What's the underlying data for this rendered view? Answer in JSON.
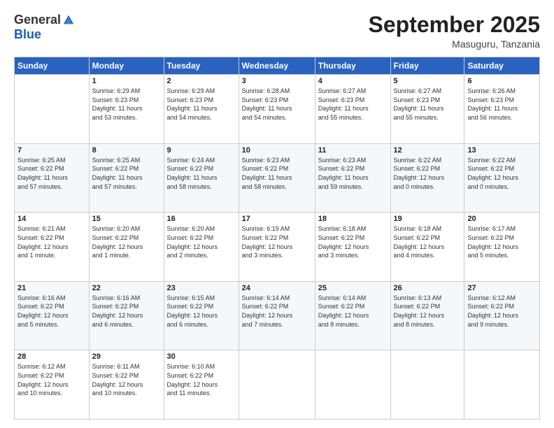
{
  "logo": {
    "general": "General",
    "blue": "Blue"
  },
  "header": {
    "month": "September 2025",
    "location": "Masuguru, Tanzania"
  },
  "weekdays": [
    "Sunday",
    "Monday",
    "Tuesday",
    "Wednesday",
    "Thursday",
    "Friday",
    "Saturday"
  ],
  "weeks": [
    [
      {
        "day": "",
        "info": ""
      },
      {
        "day": "1",
        "info": "Sunrise: 6:29 AM\nSunset: 6:23 PM\nDaylight: 11 hours\nand 53 minutes."
      },
      {
        "day": "2",
        "info": "Sunrise: 6:29 AM\nSunset: 6:23 PM\nDaylight: 11 hours\nand 54 minutes."
      },
      {
        "day": "3",
        "info": "Sunrise: 6:28 AM\nSunset: 6:23 PM\nDaylight: 11 hours\nand 54 minutes."
      },
      {
        "day": "4",
        "info": "Sunrise: 6:27 AM\nSunset: 6:23 PM\nDaylight: 11 hours\nand 55 minutes."
      },
      {
        "day": "5",
        "info": "Sunrise: 6:27 AM\nSunset: 6:23 PM\nDaylight: 11 hours\nand 55 minutes."
      },
      {
        "day": "6",
        "info": "Sunrise: 6:26 AM\nSunset: 6:23 PM\nDaylight: 11 hours\nand 56 minutes."
      }
    ],
    [
      {
        "day": "7",
        "info": "Sunrise: 6:25 AM\nSunset: 6:22 PM\nDaylight: 11 hours\nand 57 minutes."
      },
      {
        "day": "8",
        "info": "Sunrise: 6:25 AM\nSunset: 6:22 PM\nDaylight: 11 hours\nand 57 minutes."
      },
      {
        "day": "9",
        "info": "Sunrise: 6:24 AM\nSunset: 6:22 PM\nDaylight: 11 hours\nand 58 minutes."
      },
      {
        "day": "10",
        "info": "Sunrise: 6:23 AM\nSunset: 6:22 PM\nDaylight: 11 hours\nand 58 minutes."
      },
      {
        "day": "11",
        "info": "Sunrise: 6:23 AM\nSunset: 6:22 PM\nDaylight: 11 hours\nand 59 minutes."
      },
      {
        "day": "12",
        "info": "Sunrise: 6:22 AM\nSunset: 6:22 PM\nDaylight: 12 hours\nand 0 minutes."
      },
      {
        "day": "13",
        "info": "Sunrise: 6:22 AM\nSunset: 6:22 PM\nDaylight: 12 hours\nand 0 minutes."
      }
    ],
    [
      {
        "day": "14",
        "info": "Sunrise: 6:21 AM\nSunset: 6:22 PM\nDaylight: 12 hours\nand 1 minute."
      },
      {
        "day": "15",
        "info": "Sunrise: 6:20 AM\nSunset: 6:22 PM\nDaylight: 12 hours\nand 1 minute."
      },
      {
        "day": "16",
        "info": "Sunrise: 6:20 AM\nSunset: 6:22 PM\nDaylight: 12 hours\nand 2 minutes."
      },
      {
        "day": "17",
        "info": "Sunrise: 6:19 AM\nSunset: 6:22 PM\nDaylight: 12 hours\nand 3 minutes."
      },
      {
        "day": "18",
        "info": "Sunrise: 6:18 AM\nSunset: 6:22 PM\nDaylight: 12 hours\nand 3 minutes."
      },
      {
        "day": "19",
        "info": "Sunrise: 6:18 AM\nSunset: 6:22 PM\nDaylight: 12 hours\nand 4 minutes."
      },
      {
        "day": "20",
        "info": "Sunrise: 6:17 AM\nSunset: 6:22 PM\nDaylight: 12 hours\nand 5 minutes."
      }
    ],
    [
      {
        "day": "21",
        "info": "Sunrise: 6:16 AM\nSunset: 6:22 PM\nDaylight: 12 hours\nand 5 minutes."
      },
      {
        "day": "22",
        "info": "Sunrise: 6:16 AM\nSunset: 6:22 PM\nDaylight: 12 hours\nand 6 minutes."
      },
      {
        "day": "23",
        "info": "Sunrise: 6:15 AM\nSunset: 6:22 PM\nDaylight: 12 hours\nand 6 minutes."
      },
      {
        "day": "24",
        "info": "Sunrise: 6:14 AM\nSunset: 6:22 PM\nDaylight: 12 hours\nand 7 minutes."
      },
      {
        "day": "25",
        "info": "Sunrise: 6:14 AM\nSunset: 6:22 PM\nDaylight: 12 hours\nand 8 minutes."
      },
      {
        "day": "26",
        "info": "Sunrise: 6:13 AM\nSunset: 6:22 PM\nDaylight: 12 hours\nand 8 minutes."
      },
      {
        "day": "27",
        "info": "Sunrise: 6:12 AM\nSunset: 6:22 PM\nDaylight: 12 hours\nand 9 minutes."
      }
    ],
    [
      {
        "day": "28",
        "info": "Sunrise: 6:12 AM\nSunset: 6:22 PM\nDaylight: 12 hours\nand 10 minutes."
      },
      {
        "day": "29",
        "info": "Sunrise: 6:11 AM\nSunset: 6:22 PM\nDaylight: 12 hours\nand 10 minutes."
      },
      {
        "day": "30",
        "info": "Sunrise: 6:10 AM\nSunset: 6:22 PM\nDaylight: 12 hours\nand 11 minutes."
      },
      {
        "day": "",
        "info": ""
      },
      {
        "day": "",
        "info": ""
      },
      {
        "day": "",
        "info": ""
      },
      {
        "day": "",
        "info": ""
      }
    ]
  ]
}
